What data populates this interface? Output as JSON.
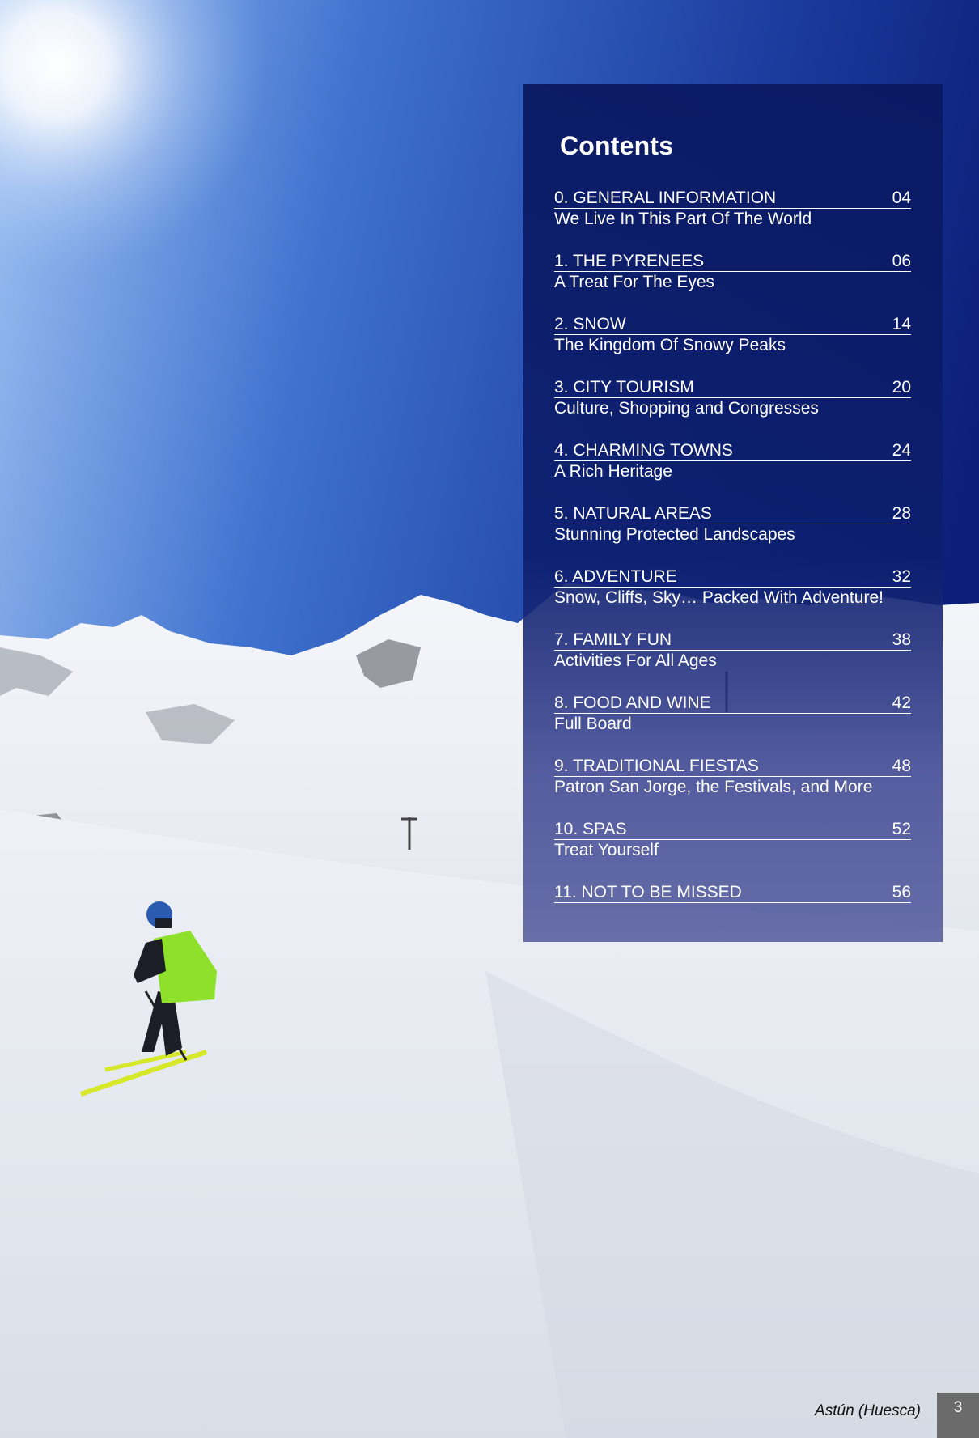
{
  "contents": {
    "title": "Contents",
    "entries": [
      {
        "heading": "0. GENERAL INFORMATION",
        "page": "04",
        "subtitle": "We Live In This Part Of The World"
      },
      {
        "heading": "1. THE PYRENEES",
        "page": "06",
        "subtitle": "A Treat For The Eyes"
      },
      {
        "heading": "2. SNOW",
        "page": "14",
        "subtitle": "The Kingdom Of Snowy Peaks"
      },
      {
        "heading": "3. CITY TOURISM",
        "page": "20",
        "subtitle": "Culture, Shopping and Congresses"
      },
      {
        "heading": "4. CHARMING TOWNS",
        "page": "24",
        "subtitle": "A Rich Heritage"
      },
      {
        "heading": "5. NATURAL AREAS",
        "page": "28",
        "subtitle": "Stunning Protected Landscapes"
      },
      {
        "heading": "6. ADVENTURE",
        "page": "32",
        "subtitle": "Snow, Cliffs, Sky… Packed With Adventure!"
      },
      {
        "heading": "7. FAMILY FUN",
        "page": "38",
        "subtitle": "Activities For All Ages"
      },
      {
        "heading": "8. FOOD AND WINE",
        "page": "42",
        "subtitle": "Full Board"
      },
      {
        "heading": "9. TRADITIONAL FIESTAS",
        "page": "48",
        "subtitle": "Patron San Jorge, the Festivals, and More"
      },
      {
        "heading": "10. SPAS",
        "page": "52",
        "subtitle": "Treat Yourself"
      },
      {
        "heading": "11. NOT TO BE MISSED",
        "page": "56",
        "subtitle": ""
      }
    ]
  },
  "photo": {
    "caption": "Astún (Huesca)",
    "sky_color": "#1f3fa0",
    "snow_color": "#e8ebf0",
    "jacket_color": "#8ee02a"
  },
  "page_number": "3"
}
